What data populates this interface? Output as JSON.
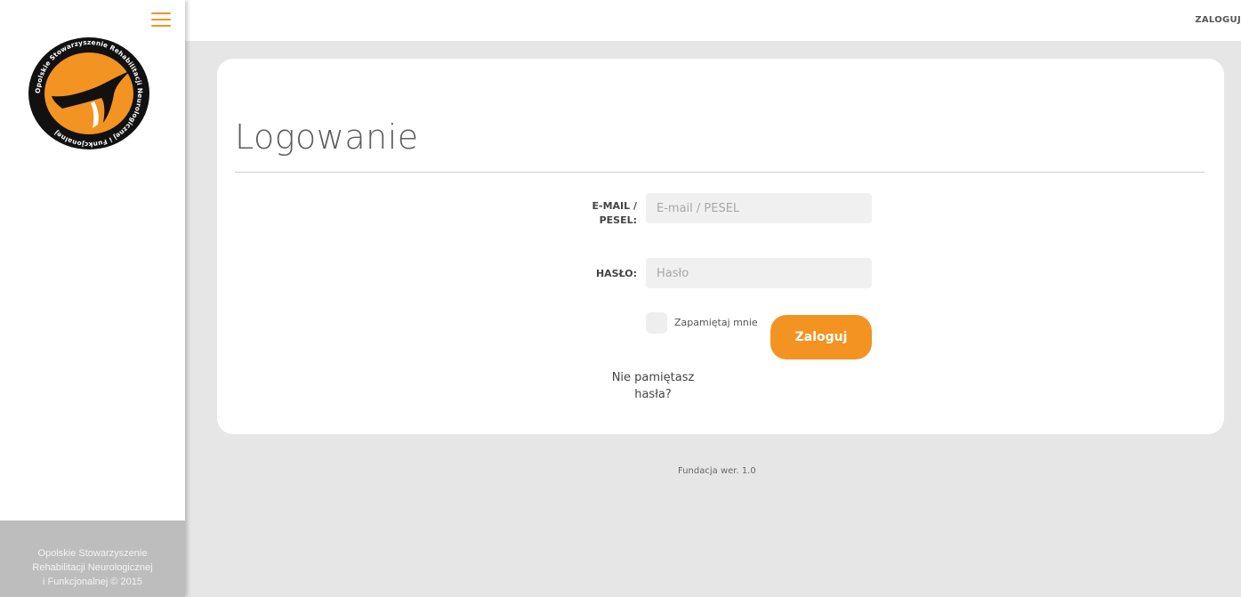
{
  "topbar": {
    "login_label": "ZALOGUJ"
  },
  "sidebar": {
    "footer_lines": [
      "Opolskie Stowarzyszenie",
      "Rehabilitacji Neurologicznej",
      "i Funkcjonalnej © 2015"
    ],
    "logo_ring_text": "Opolskie Stowarzyszenie Rehabilitacji Neurologicznej i Funkcjonalnej"
  },
  "page": {
    "title": "Logowanie"
  },
  "form": {
    "email_label_line1": "E-MAIL /",
    "email_label_line2": "PESEL:",
    "email_placeholder": "E-mail / PESEL",
    "email_value": "",
    "password_label": "HASŁO:",
    "password_placeholder": "Hasło",
    "password_value": "",
    "remember_label": "Zapamiętaj mnie",
    "submit_label": "Zaloguj",
    "forgot_line1": "Nie pamiętasz",
    "forgot_line2": "hasła?"
  },
  "footer": {
    "version": "Fundacja wer. 1.0"
  },
  "colors": {
    "accent": "#f39322",
    "background": "#e6e6e6",
    "card": "#ffffff",
    "sidebar_footer": "#bdbdbd"
  },
  "icons": {
    "menu": "hamburger-menu-icon",
    "logo": "association-logo"
  }
}
